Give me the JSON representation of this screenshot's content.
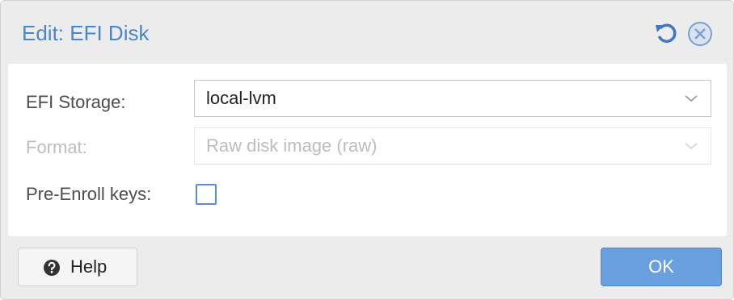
{
  "dialog": {
    "title": "Edit: EFI Disk",
    "tools": {
      "reset_icon": "reset-icon",
      "close_icon": "close-icon"
    }
  },
  "form": {
    "efi_storage": {
      "label": "EFI Storage:",
      "value": "local-lvm",
      "enabled": true
    },
    "format": {
      "label": "Format:",
      "value": "Raw disk image (raw)",
      "enabled": false
    },
    "pre_enroll_keys": {
      "label": "Pre-Enroll keys:",
      "checked": false
    }
  },
  "footer": {
    "help_label": "Help",
    "help_icon": "question-circle-icon",
    "ok_label": "OK"
  },
  "colors": {
    "accent": "#4a86c8",
    "ok_button": "#6a9fe0",
    "disabled_text": "#bdbdbd"
  }
}
